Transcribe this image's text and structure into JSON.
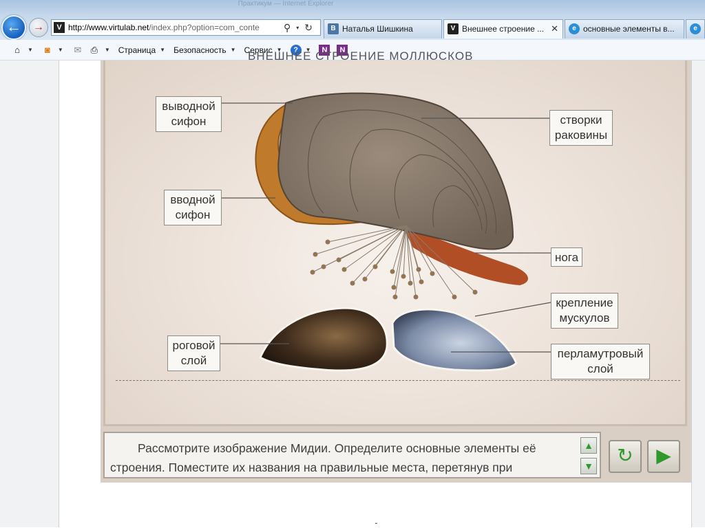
{
  "browser": {
    "faded_title": "Практикум — Internet Explorer",
    "address": {
      "host": "http://www.virtulab.net",
      "path": "/index.php?option=com_conte"
    },
    "tabs": [
      {
        "icon": "vk-icon",
        "label": "Наталья Шишкина",
        "icon_text": "В",
        "color": "#4a76a8"
      },
      {
        "icon": "virtulab-icon",
        "label": "Внешнее строение ...",
        "icon_text": "V",
        "color": "#222222",
        "close": "✕"
      },
      {
        "icon": "ie-page-icon",
        "label": "основные элементы в...",
        "icon_text": "e",
        "color": "#2a8fd6"
      },
      {
        "icon": "ie-page-icon",
        "label": "",
        "icon_text": "e",
        "color": "#2a8fd6"
      }
    ],
    "commands": {
      "page": "Страница",
      "security": "Безопасность",
      "service": "Сервис",
      "help": "?",
      "n1": "N",
      "n2": "N"
    }
  },
  "lab": {
    "title": "ВНЕШНЕЕ СТРОЕНИЕ МОЛЛЮСКОВ",
    "labels": {
      "exhalant_siphon_1": "выводной",
      "exhalant_siphon_2": "сифон",
      "inhalant_siphon_1": "вводной",
      "inhalant_siphon_2": "сифон",
      "valves_1": "створки",
      "valves_2": "раковины",
      "foot": "нога",
      "muscle_1": "крепление",
      "muscle_2": "мускулов",
      "horny_1": "роговой",
      "horny_2": "слой",
      "nacre_1": "перламутровый",
      "nacre_2": "слой"
    },
    "instruction_line1": "Рассмотрите изображение Мидии. Определите основные элементы её",
    "instruction_line2": "строения. Поместите их названия на правильные места, перетянув при",
    "buttons": {
      "scroll_up": "▲",
      "scroll_down": "▼",
      "reset": "↻",
      "next": "▶"
    }
  }
}
